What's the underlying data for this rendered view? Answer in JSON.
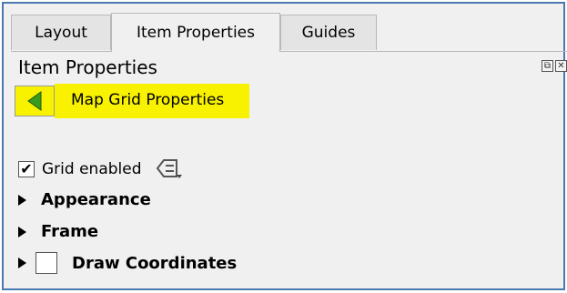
{
  "tabs": [
    {
      "label": "Layout",
      "active": false
    },
    {
      "label": "Item Properties",
      "active": true
    },
    {
      "label": "Guides",
      "active": false
    }
  ],
  "panel": {
    "title": "Item Properties",
    "back_button": {
      "label": "Map Grid Properties"
    }
  },
  "grid": {
    "enabled_label": "Grid enabled",
    "enabled": true,
    "sections": [
      {
        "label": "Appearance",
        "collapsed": true
      },
      {
        "label": "Frame",
        "collapsed": true
      },
      {
        "label": "Draw Coordinates",
        "collapsed": true,
        "checked": false
      }
    ]
  },
  "colors": {
    "highlight": "#f8f200",
    "back_arrow": "#3a9a1e",
    "frame_border": "#4a78b0"
  },
  "icons": [
    "back-arrow-icon",
    "data-defined-override-icon",
    "float-dock-icon",
    "close-dock-icon",
    "expand-arrow-icon"
  ]
}
